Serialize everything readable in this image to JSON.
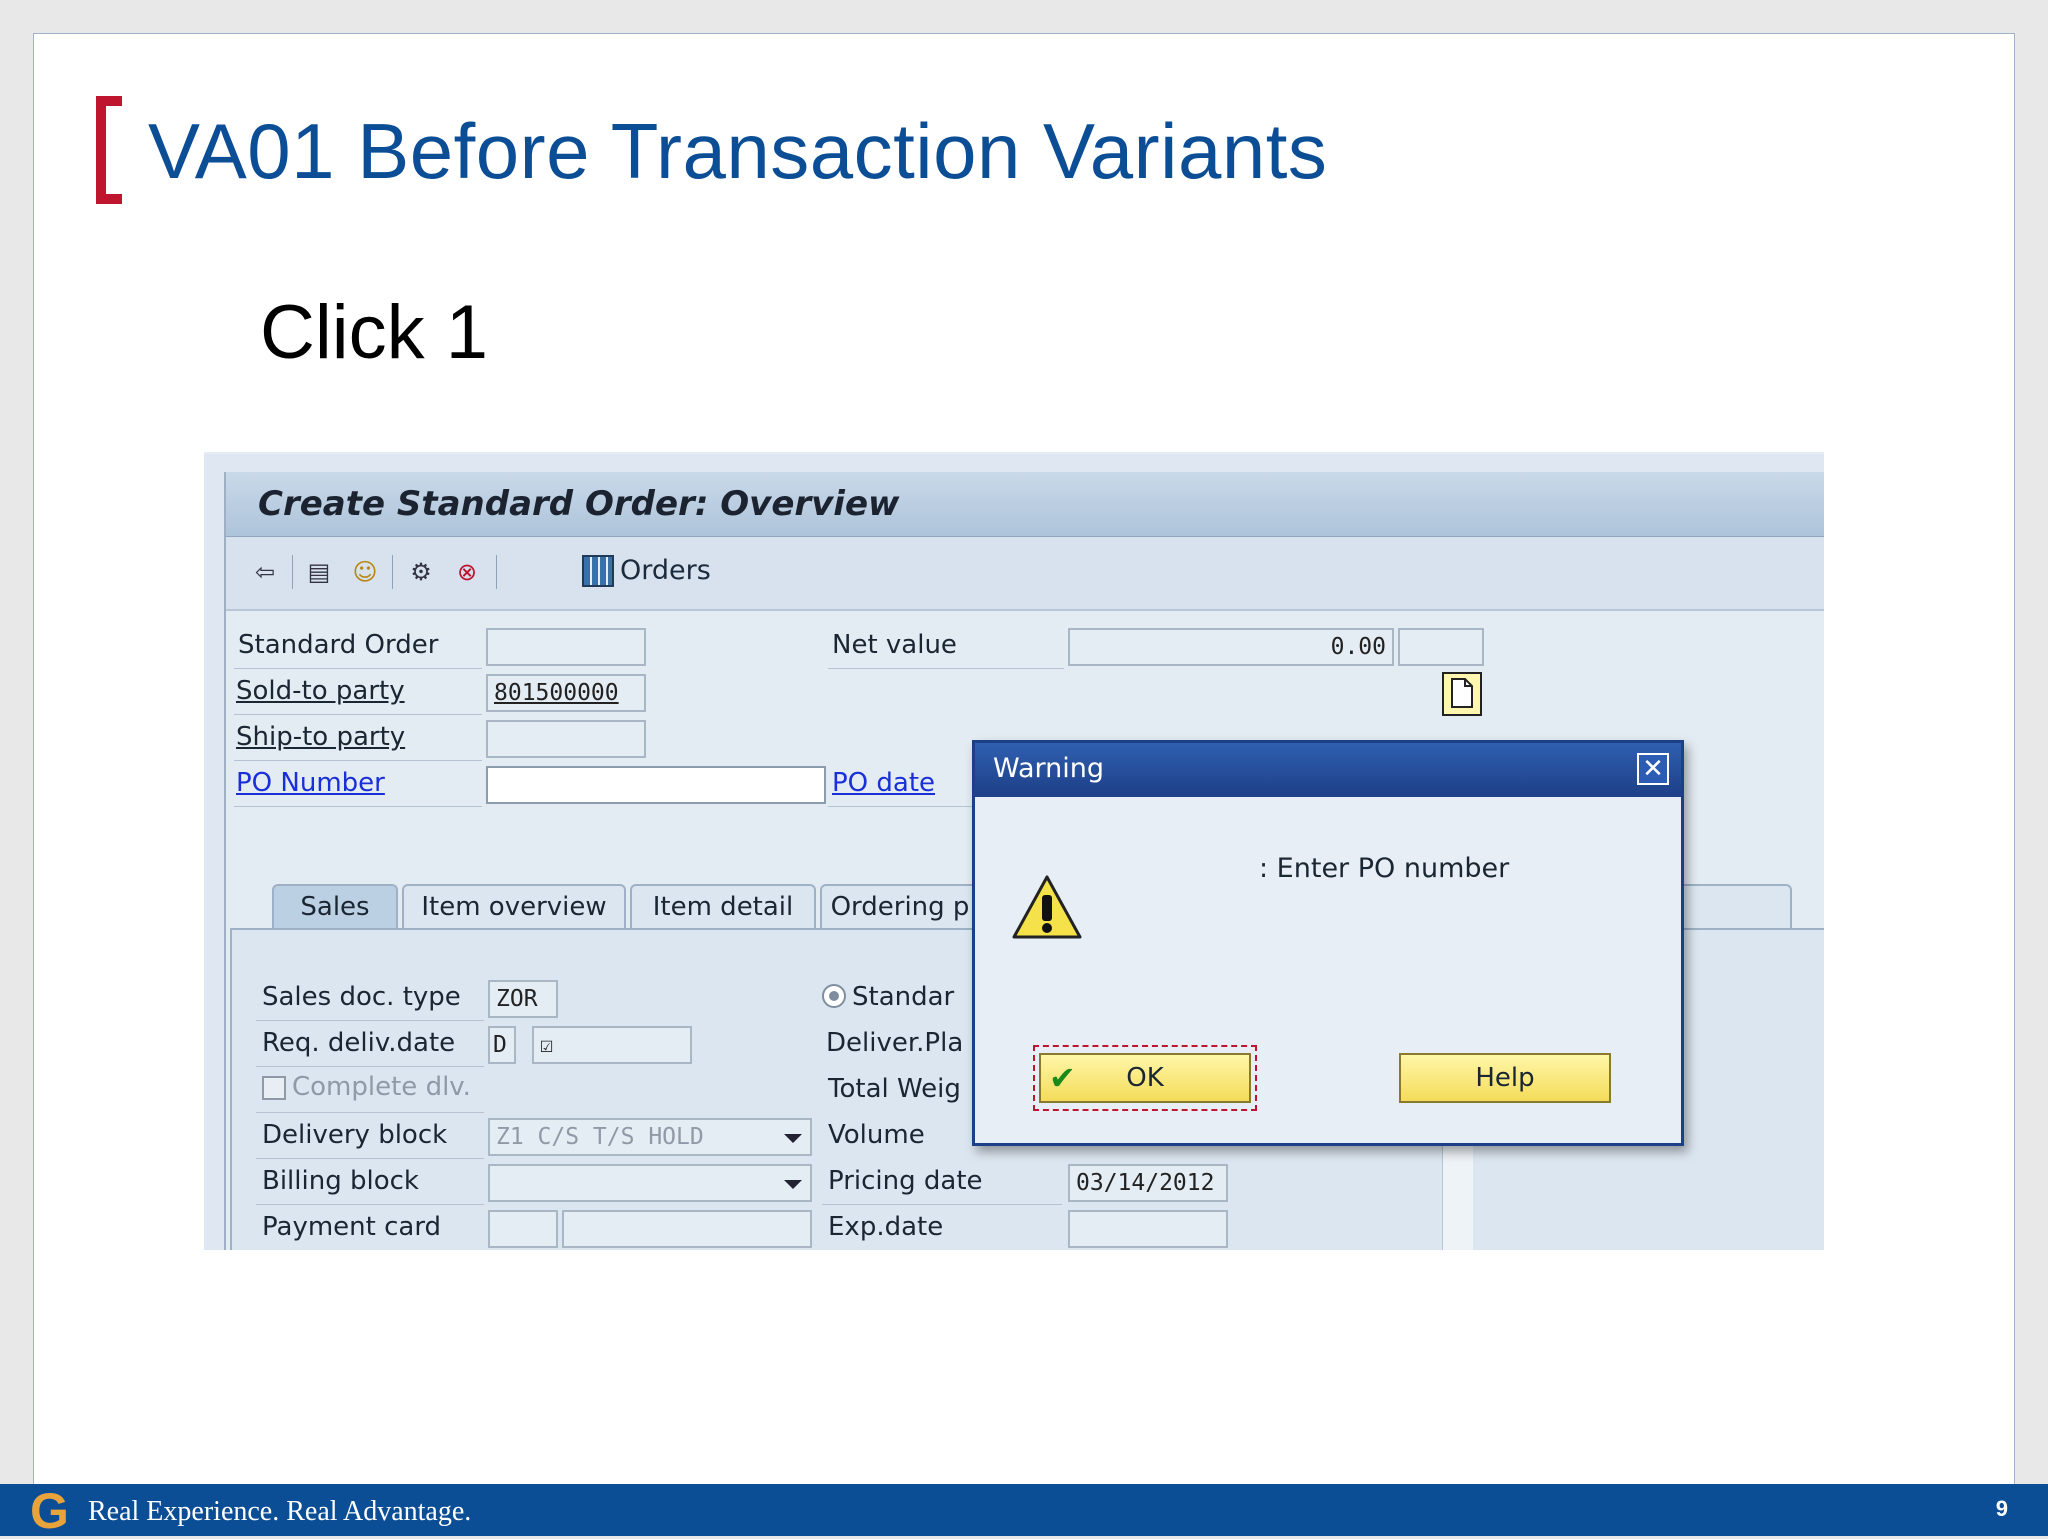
{
  "slide": {
    "title": "VA01 Before Transaction Variants",
    "subtitle": "Click 1",
    "footer": {
      "logo": "G",
      "tagline": "Real Experience. Real Advantage.",
      "page_number": "9"
    }
  },
  "sap": {
    "window_title": "Create Standard Order: Overview",
    "toolbar": {
      "orders_label": "Orders",
      "icons": [
        "display-doc-icon",
        "header-icon",
        "partner-icon",
        "pricing-icon",
        "delete-icon",
        "orders-grid-icon"
      ]
    },
    "header": {
      "standard_order_label": "Standard Order",
      "standard_order_value": "",
      "sold_to_label": "Sold-to party",
      "sold_to_value": "801500000",
      "ship_to_label": "Ship-to party",
      "ship_to_value": "",
      "po_number_label": "PO Number",
      "po_number_value": "",
      "net_value_label": "Net value",
      "net_value": "0.00",
      "currency": "",
      "po_date_label": "PO date"
    },
    "tabs": [
      {
        "label": "Sales",
        "active": true
      },
      {
        "label": "Item overview",
        "active": false
      },
      {
        "label": "Item detail",
        "active": false
      },
      {
        "label": "Ordering p",
        "active": false
      }
    ],
    "sales_tab": {
      "sales_doc_type_label": "Sales doc. type",
      "sales_doc_type_value": "ZOR",
      "req_deliv_date_label": "Req. deliv.date",
      "req_deliv_date_prefix": "D",
      "complete_dlv_label": "Complete dlv.",
      "delivery_block_label": "Delivery block",
      "delivery_block_value": "Z1 C/S T/S HOLD",
      "billing_block_label": "Billing block",
      "billing_block_value": "",
      "payment_card_label": "Payment card",
      "standard_label": "Standar",
      "deliver_plant_label": "Deliver.Pla",
      "total_weight_label": "Total Weig",
      "volume_label": "Volume",
      "pricing_date_label": "Pricing date",
      "pricing_date_value": "03/14/2012",
      "exp_date_label": "Exp.date"
    },
    "dialog": {
      "title": "Warning",
      "message": ": Enter PO number",
      "ok_label": "OK",
      "help_label": "Help",
      "close_glyph": "✕"
    }
  },
  "colors": {
    "title_blue": "#0b4e96",
    "accent_red": "#c0152f",
    "sap_bg": "#e3ebf3",
    "dialog_title": "#1d3f87",
    "button_yellow": "#f4dc5a"
  }
}
